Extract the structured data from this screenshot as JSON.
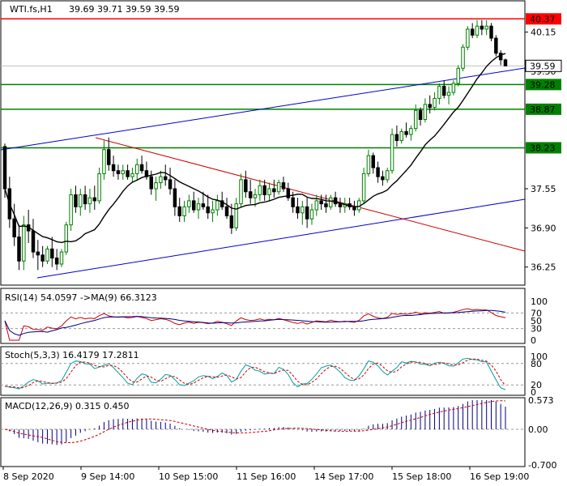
{
  "colors": {
    "bull": "#008000",
    "bear": "#000000",
    "ma": "#000000",
    "resistance_red": "#ff0000",
    "support_green": "#008000",
    "channel_blue": "#0000cc",
    "trend_red": "#cc0000",
    "rsi_main": "#cc0000",
    "rsi_ma": "#000080",
    "stoch_main": "#00a0a0",
    "stoch_signal": "#cc0000",
    "macd_hist": "#000080",
    "macd_signal": "#cc0000"
  },
  "header": {
    "symbol": "WTI.fs,H1",
    "ohlc": "39.69 39.71 39.59 39.59"
  },
  "chart_data": [
    {
      "panel": "price",
      "type": "candlestick",
      "x_ticks": [
        "8 Sep 2020",
        "9 Sep 14:00",
        "10 Sep 15:00",
        "11 Sep 16:00",
        "14 Sep 17:00",
        "15 Sep 18:00",
        "16 Sep 19:00"
      ],
      "y_ticks": [
        "40.15",
        "39.50",
        "37.55",
        "36.90",
        "36.25"
      ],
      "ylim": [
        35.95,
        40.67
      ],
      "levels": [
        {
          "label": "40.37",
          "value": 40.37,
          "color": "#ff0000"
        },
        {
          "label": "39.28",
          "value": 39.28,
          "color": "#008000"
        },
        {
          "label": "38.87",
          "value": 38.87,
          "color": "#008000"
        },
        {
          "label": "38.23",
          "value": 38.23,
          "color": "#008000"
        }
      ],
      "current_price": "39.59",
      "candles": [
        [
          38.25,
          38.3,
          37.4,
          37.55
        ],
        [
          37.55,
          37.75,
          36.9,
          37.05
        ],
        [
          37.05,
          37.3,
          36.6,
          36.75
        ],
        [
          36.75,
          36.95,
          36.2,
          36.35
        ],
        [
          36.35,
          37.1,
          36.2,
          36.95
        ],
        [
          36.95,
          37.2,
          36.65,
          36.85
        ],
        [
          36.85,
          37.05,
          36.4,
          36.5
        ],
        [
          36.5,
          36.7,
          36.2,
          36.45
        ],
        [
          36.45,
          36.6,
          36.25,
          36.35
        ],
        [
          36.35,
          36.6,
          36.3,
          36.55
        ],
        [
          36.55,
          36.75,
          36.25,
          36.4
        ],
        [
          36.4,
          36.55,
          36.2,
          36.3
        ],
        [
          36.3,
          36.55,
          36.25,
          36.5
        ],
        [
          36.5,
          37.0,
          36.45,
          36.95
        ],
        [
          36.95,
          37.55,
          36.85,
          37.45
        ],
        [
          37.45,
          37.6,
          37.15,
          37.25
        ],
        [
          37.25,
          37.55,
          37.1,
          37.45
        ],
        [
          37.45,
          37.6,
          37.2,
          37.3
        ],
        [
          37.3,
          37.55,
          37.15,
          37.4
        ],
        [
          37.4,
          37.6,
          37.2,
          37.35
        ],
        [
          37.35,
          37.9,
          37.3,
          37.8
        ],
        [
          37.8,
          38.35,
          37.7,
          38.2
        ],
        [
          38.2,
          38.4,
          37.85,
          37.95
        ],
        [
          37.95,
          38.1,
          37.75,
          37.85
        ],
        [
          37.85,
          37.95,
          37.7,
          37.8
        ],
        [
          37.8,
          37.95,
          37.7,
          37.85
        ],
        [
          37.85,
          37.95,
          37.7,
          37.75
        ],
        [
          37.75,
          37.9,
          37.65,
          37.8
        ],
        [
          37.8,
          38.05,
          37.7,
          37.95
        ],
        [
          37.95,
          38.1,
          37.8,
          37.85
        ],
        [
          37.85,
          38.0,
          37.7,
          37.75
        ],
        [
          37.75,
          37.85,
          37.45,
          37.55
        ],
        [
          37.55,
          37.75,
          37.35,
          37.65
        ],
        [
          37.65,
          37.85,
          37.55,
          37.75
        ],
        [
          37.75,
          37.95,
          37.6,
          37.7
        ],
        [
          37.7,
          37.9,
          37.45,
          37.55
        ],
        [
          37.55,
          37.7,
          37.1,
          37.25
        ],
        [
          37.25,
          37.4,
          37.0,
          37.1
        ],
        [
          37.1,
          37.35,
          37.0,
          37.25
        ],
        [
          37.25,
          37.45,
          37.15,
          37.35
        ],
        [
          37.35,
          37.5,
          37.15,
          37.2
        ],
        [
          37.2,
          37.4,
          37.05,
          37.3
        ],
        [
          37.3,
          37.5,
          37.2,
          37.25
        ],
        [
          37.25,
          37.45,
          37.05,
          37.15
        ],
        [
          37.15,
          37.35,
          37.0,
          37.2
        ],
        [
          37.2,
          37.45,
          37.1,
          37.35
        ],
        [
          37.35,
          37.5,
          37.2,
          37.25
        ],
        [
          37.25,
          37.4,
          37.05,
          37.1
        ],
        [
          37.1,
          37.3,
          36.8,
          36.9
        ],
        [
          36.9,
          37.4,
          36.85,
          37.3
        ],
        [
          37.3,
          37.8,
          37.25,
          37.7
        ],
        [
          37.7,
          37.85,
          37.4,
          37.5
        ],
        [
          37.5,
          37.7,
          37.3,
          37.4
        ],
        [
          37.4,
          37.55,
          37.25,
          37.45
        ],
        [
          37.45,
          37.7,
          37.35,
          37.6
        ],
        [
          37.6,
          37.7,
          37.35,
          37.45
        ],
        [
          37.45,
          37.65,
          37.35,
          37.55
        ],
        [
          37.55,
          37.7,
          37.4,
          37.5
        ],
        [
          37.5,
          37.7,
          37.45,
          37.65
        ],
        [
          37.65,
          37.75,
          37.5,
          37.55
        ],
        [
          37.55,
          37.65,
          37.35,
          37.4
        ],
        [
          37.4,
          37.5,
          37.15,
          37.25
        ],
        [
          37.25,
          37.4,
          37.05,
          37.15
        ],
        [
          37.15,
          37.35,
          36.95,
          37.25
        ],
        [
          37.25,
          37.4,
          36.9,
          37.05
        ],
        [
          37.05,
          37.3,
          36.95,
          37.2
        ],
        [
          37.2,
          37.45,
          37.1,
          37.35
        ],
        [
          37.35,
          37.45,
          37.2,
          37.3
        ],
        [
          37.3,
          37.45,
          37.15,
          37.25
        ],
        [
          37.25,
          37.45,
          37.2,
          37.4
        ],
        [
          37.4,
          37.5,
          37.25,
          37.3
        ],
        [
          37.3,
          37.4,
          37.15,
          37.25
        ],
        [
          37.25,
          37.4,
          37.15,
          37.3
        ],
        [
          37.3,
          37.4,
          37.2,
          37.25
        ],
        [
          37.25,
          37.35,
          37.1,
          37.2
        ],
        [
          37.2,
          37.4,
          37.15,
          37.35
        ],
        [
          37.35,
          37.9,
          37.3,
          37.8
        ],
        [
          37.8,
          38.2,
          37.75,
          38.1
        ],
        [
          38.1,
          38.15,
          37.8,
          37.9
        ],
        [
          37.9,
          38.0,
          37.65,
          37.75
        ],
        [
          37.75,
          37.85,
          37.6,
          37.7
        ],
        [
          37.7,
          37.9,
          37.65,
          37.85
        ],
        [
          37.85,
          38.55,
          37.8,
          38.45
        ],
        [
          38.45,
          38.6,
          38.25,
          38.35
        ],
        [
          38.35,
          38.55,
          38.3,
          38.5
        ],
        [
          38.5,
          38.65,
          38.4,
          38.45
        ],
        [
          38.45,
          38.6,
          38.35,
          38.55
        ],
        [
          38.55,
          38.95,
          38.5,
          38.85
        ],
        [
          38.85,
          38.9,
          38.6,
          38.7
        ],
        [
          38.7,
          39.05,
          38.65,
          38.95
        ],
        [
          38.95,
          39.1,
          38.8,
          38.9
        ],
        [
          38.9,
          39.15,
          38.85,
          39.05
        ],
        [
          39.05,
          39.3,
          38.95,
          39.25
        ],
        [
          39.25,
          39.35,
          39.05,
          39.1
        ],
        [
          39.1,
          39.25,
          38.95,
          39.15
        ],
        [
          39.15,
          39.35,
          39.1,
          39.3
        ],
        [
          39.3,
          39.6,
          39.25,
          39.55
        ],
        [
          39.55,
          39.95,
          39.5,
          39.9
        ],
        [
          39.9,
          40.25,
          39.85,
          40.2
        ],
        [
          40.2,
          40.3,
          40.05,
          40.1
        ],
        [
          40.1,
          40.35,
          40.05,
          40.25
        ],
        [
          40.25,
          40.35,
          40.1,
          40.2
        ],
        [
          40.2,
          40.35,
          40.1,
          40.25
        ],
        [
          40.25,
          40.3,
          40.0,
          40.05
        ],
        [
          40.05,
          40.1,
          39.75,
          39.8
        ],
        [
          39.8,
          39.85,
          39.6,
          39.69
        ],
        [
          39.69,
          39.71,
          39.59,
          39.59
        ]
      ]
    },
    {
      "panel": "rsi",
      "type": "line",
      "title": "RSI(14) 54.0597  ->MA(9) 66.3123",
      "y_ticks": [
        "100",
        "70",
        "50",
        "30",
        "0"
      ],
      "levels": [
        70,
        30
      ],
      "ylim": [
        0,
        100
      ]
    },
    {
      "panel": "stoch",
      "type": "line",
      "title": "Stoch(5,3,3) 16.4179 17.2811",
      "y_ticks": [
        "100",
        "80",
        "20",
        "0"
      ],
      "levels": [
        80,
        20
      ],
      "ylim": [
        0,
        100
      ]
    },
    {
      "panel": "macd",
      "type": "bar",
      "title": "MACD(12,26,9) 0.315 0.450",
      "y_ticks": [
        "0.573",
        "0.00",
        "-0.700"
      ],
      "ylim": [
        -0.7,
        0.573
      ]
    }
  ]
}
